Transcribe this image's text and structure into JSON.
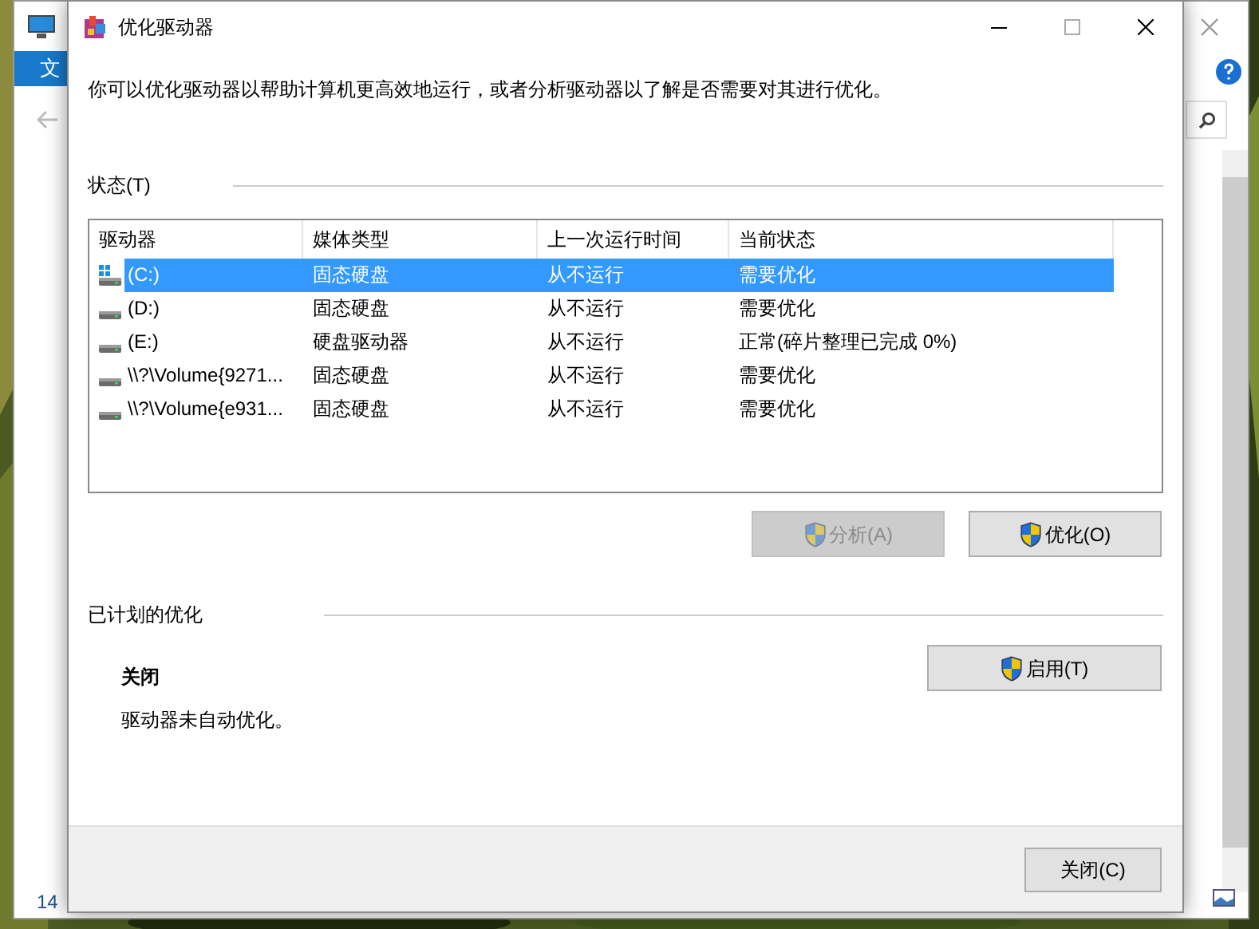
{
  "background_window": {
    "ribbon_tab": "文",
    "item_count": "14"
  },
  "dialog": {
    "title": "优化驱动器",
    "description": "你可以优化驱动器以帮助计算机更高效地运行，或者分析驱动器以了解是否需要对其进行优化。",
    "status_heading": "状态(T)",
    "columns": [
      "驱动器",
      "媒体类型",
      "上一次运行时间",
      "当前状态"
    ],
    "drives": [
      {
        "kind": "system",
        "name": "(C:)",
        "media": "固态硬盘",
        "last_run": "从不运行",
        "status": "需要优化",
        "selected": true
      },
      {
        "kind": "drive",
        "name": "(D:)",
        "media": "固态硬盘",
        "last_run": "从不运行",
        "status": "需要优化",
        "selected": false
      },
      {
        "kind": "drive",
        "name": "(E:)",
        "media": "硬盘驱动器",
        "last_run": "从不运行",
        "status": "正常(碎片整理已完成 0%)",
        "selected": false
      },
      {
        "kind": "drive",
        "name": "\\\\?\\Volume{9271...",
        "media": "固态硬盘",
        "last_run": "从不运行",
        "status": "需要优化",
        "selected": false
      },
      {
        "kind": "drive",
        "name": "\\\\?\\Volume{e931...",
        "media": "固态硬盘",
        "last_run": "从不运行",
        "status": "需要优化",
        "selected": false
      }
    ],
    "actions": [
      {
        "label": "分析(A)",
        "disabled": true
      },
      {
        "label": "优化(O)",
        "disabled": false
      }
    ],
    "schedule_heading": "已计划的优化",
    "schedule_state": "关闭",
    "schedule_note": "驱动器未自动优化。",
    "enable_button": "启用(T)",
    "close_button": "关闭(C)"
  }
}
